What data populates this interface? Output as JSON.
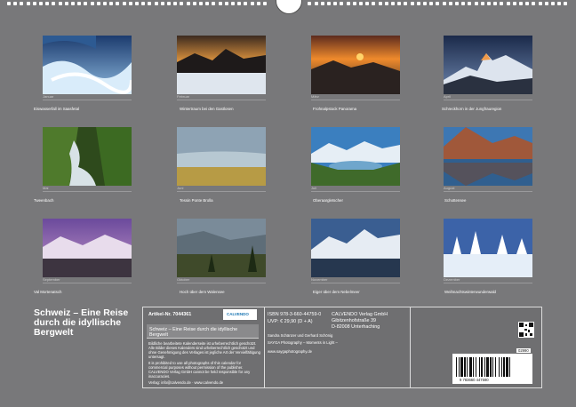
{
  "months": [
    {
      "caption": "Eiswasserfall im Saasfetal",
      "label": "Januar"
    },
    {
      "caption": "Wintertraum bei den Gastlosen",
      "label": "Februar"
    },
    {
      "caption": "Frohnalpstock Panorama",
      "label": "März"
    },
    {
      "caption": "Schreckhorn in der Jungfrauregion",
      "label": "April"
    },
    {
      "caption": "Tweenbach",
      "label": "Mai"
    },
    {
      "caption": "Tessin Ponte Brolla",
      "label": "Juni"
    },
    {
      "caption": "Oberaargletscher",
      "label": "Juli"
    },
    {
      "caption": "Schottensee",
      "label": "August"
    },
    {
      "caption": "Val Mortenatsch",
      "label": "September"
    },
    {
      "caption": "Hoch über dem Walensee",
      "label": "Oktober"
    },
    {
      "caption": "Eiger über dem Nebelmeer",
      "label": "November"
    },
    {
      "caption": "Weihnachtswinterwunderwald",
      "label": "Dezember"
    }
  ],
  "title": "Schweiz – Eine Reise durch die idyllische Bergwelt",
  "info": {
    "article_no": "Artikel-Nr. 7044361",
    "publisher_logo": "CALVENDO",
    "subtitle": "Schweiz – Eine Reise durch die idyllische Bergwelt",
    "legal_1": "Bildliche bearbeitete Kalenderseite ist urheberrechtlich geschützt. Alle Bilder dieses Kalenders sind urheberrechtlich geschützt und ohne Genehmigung des Verlages ist jegliche Art der Vervielfältigung untersagt.",
    "legal_2": "It is prohibited to use all photographs of this calendar for commercial purposes without permission of the publisher. CALVENDO Verlag GmbH cannot be held responsible for any inaccuracies.",
    "contact": "Verlag: info@calvendo.de · www.calvendo.de",
    "isbn": "ISBN 978-3-660-44759-0",
    "price": "UVP: € 29,90 (D + A)",
    "authors": "Sandra Schänzer und Gerhard Schönig",
    "company": "SAYGA Photography – Moments in Light –",
    "website": "www.saygaphotography.de",
    "publisher_name": "CALVENDO Verlag GmbH",
    "publisher_street": "Gibitzenhofstraße 39",
    "publisher_city": "D-82008 Unterhaching",
    "code_small": "02990",
    "barcode_digits": "9 783660 447590"
  },
  "colors": {
    "background": "#78787a",
    "text": "#ffffff"
  }
}
